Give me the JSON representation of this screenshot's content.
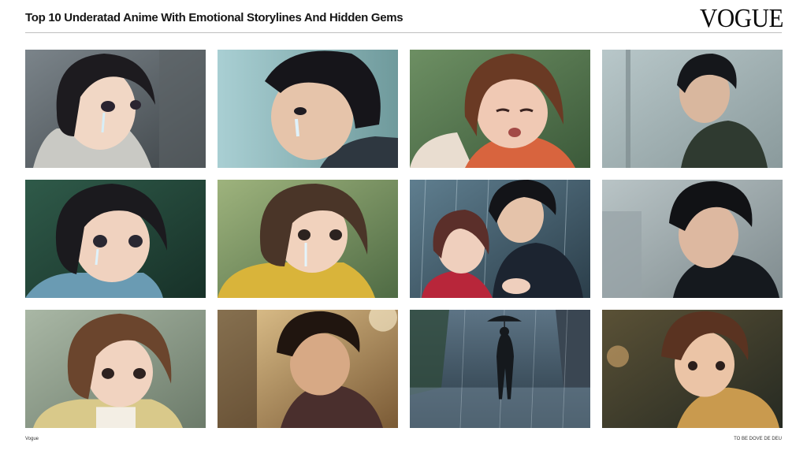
{
  "header": {
    "title": "Top 10 Underatad Anime With Emotional Storylines And Hidden Gems",
    "brand": "VOGUE"
  },
  "colors": {
    "background": "#ffffff",
    "rule": "#bfbfbf",
    "text": "#161616"
  },
  "gallery": {
    "rows": 3,
    "columns": 4,
    "tiles": [
      {
        "subject": "girl with dark bob crying",
        "palette": "grey rainy street"
      },
      {
        "subject": "boy in profile with tear",
        "palette": "teal sky"
      },
      {
        "subject": "brown-haired girl sobbing in orange jacket",
        "palette": "green foliage"
      },
      {
        "subject": "boy in profile in green jacket",
        "palette": "grey rain"
      },
      {
        "subject": "girl with tearful eyes",
        "palette": "dark green"
      },
      {
        "subject": "girl in yellow hoodie crying",
        "palette": "warm green"
      },
      {
        "subject": "couple embracing in rain",
        "palette": "blue rain"
      },
      {
        "subject": "boy in profile in dark jacket",
        "palette": "grey city"
      },
      {
        "subject": "girl with brown bob looking sad",
        "palette": "soft green"
      },
      {
        "subject": "boy looking down in warm light",
        "palette": "amber interior"
      },
      {
        "subject": "person walking with umbrella on rainy street",
        "palette": "blue rain"
      },
      {
        "subject": "brown-haired boy looking sideways",
        "palette": "dark amber"
      }
    ]
  },
  "footer": {
    "left": "Vogue",
    "right": "TO BE DOVE DE DEU"
  }
}
